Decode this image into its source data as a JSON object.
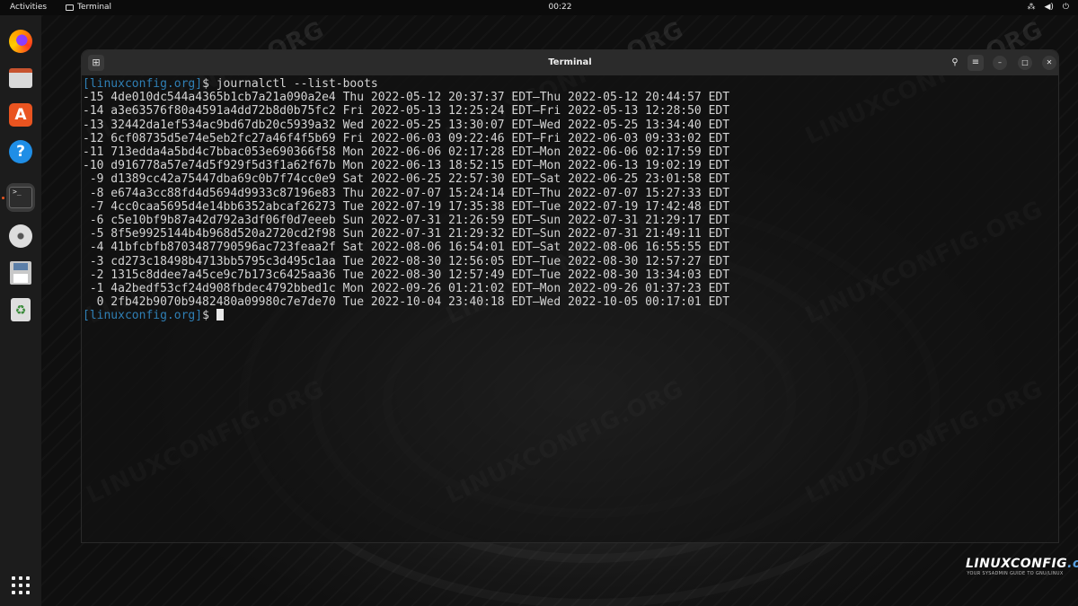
{
  "topbar": {
    "activities": "Activities",
    "app_name": "Terminal",
    "clock": "00:22"
  },
  "window": {
    "title": "Terminal"
  },
  "terminal": {
    "host": "[linuxconfig.org]",
    "prompt_suffix": "$ ",
    "command": "journalctl --list-boots",
    "output_lines": [
      "-15 4de010dc544a4365b1cb7a21a090a2e4 Thu 2022-05-12 20:37:37 EDT—Thu 2022-05-12 20:44:57 EDT",
      "-14 a3e63576f80a4591a4dd72b8d0b75fc2 Fri 2022-05-13 12:25:24 EDT—Fri 2022-05-13 12:28:50 EDT",
      "-13 32442da1ef534ac9bd67db20c5939a32 Wed 2022-05-25 13:30:07 EDT—Wed 2022-05-25 13:34:40 EDT",
      "-12 6cf08735d5e74e5eb2fc27a46f4f5b69 Fri 2022-06-03 09:22:46 EDT—Fri 2022-06-03 09:33:02 EDT",
      "-11 713edda4a5bd4c7bbac053e690366f58 Mon 2022-06-06 02:17:28 EDT—Mon 2022-06-06 02:17:59 EDT",
      "-10 d916778a57e74d5f929f5d3f1a62f67b Mon 2022-06-13 18:52:15 EDT—Mon 2022-06-13 19:02:19 EDT",
      " -9 d1389cc42a75447dba69c0b7f74cc0e9 Sat 2022-06-25 22:57:30 EDT—Sat 2022-06-25 23:01:58 EDT",
      " -8 e674a3cc88fd4d5694d9933c87196e83 Thu 2022-07-07 15:24:14 EDT—Thu 2022-07-07 15:27:33 EDT",
      " -7 4cc0caa5695d4e14bb6352abcaf26273 Tue 2022-07-19 17:35:38 EDT—Tue 2022-07-19 17:42:48 EDT",
      " -6 c5e10bf9b87a42d792a3df06f0d7eeeb Sun 2022-07-31 21:26:59 EDT—Sun 2022-07-31 21:29:17 EDT",
      " -5 8f5e9925144b4b968d520a2720cd2f98 Sun 2022-07-31 21:29:32 EDT—Sun 2022-07-31 21:49:11 EDT",
      " -4 41bfcbfb8703487790596ac723feaa2f Sat 2022-08-06 16:54:01 EDT—Sat 2022-08-06 16:55:55 EDT",
      " -3 cd273c18498b4713bb5795c3d495c1aa Tue 2022-08-30 12:56:05 EDT—Tue 2022-08-30 12:57:27 EDT",
      " -2 1315c8ddee7a45ce9c7b173c6425aa36 Tue 2022-08-30 12:57:49 EDT—Tue 2022-08-30 13:34:03 EDT",
      " -1 4a2bedf53cf24d908fbdec4792bbed1c Mon 2022-09-26 01:21:02 EDT—Mon 2022-09-26 01:37:23 EDT",
      "  0 2fb42b9070b9482480a09980c7e7de70 Tue 2022-10-04 23:40:18 EDT—Wed 2022-10-05 00:17:01 EDT"
    ]
  },
  "dock": {
    "icons": [
      "firefox-icon",
      "files-icon",
      "app-center-icon",
      "help-icon",
      "terminal-icon",
      "disc-icon",
      "save-icon",
      "trash-icon",
      "show-apps-icon"
    ]
  },
  "watermark": "LINUXCONFIG.ORG",
  "logo": {
    "name": "LINUXCONFIG",
    "suffix": ".org",
    "tagline": "YOUR SYSADMIN GUIDE TO GNU/LINUX"
  },
  "colors": {
    "prompt_host": "#2f7fb5",
    "accent": "#e95420"
  }
}
